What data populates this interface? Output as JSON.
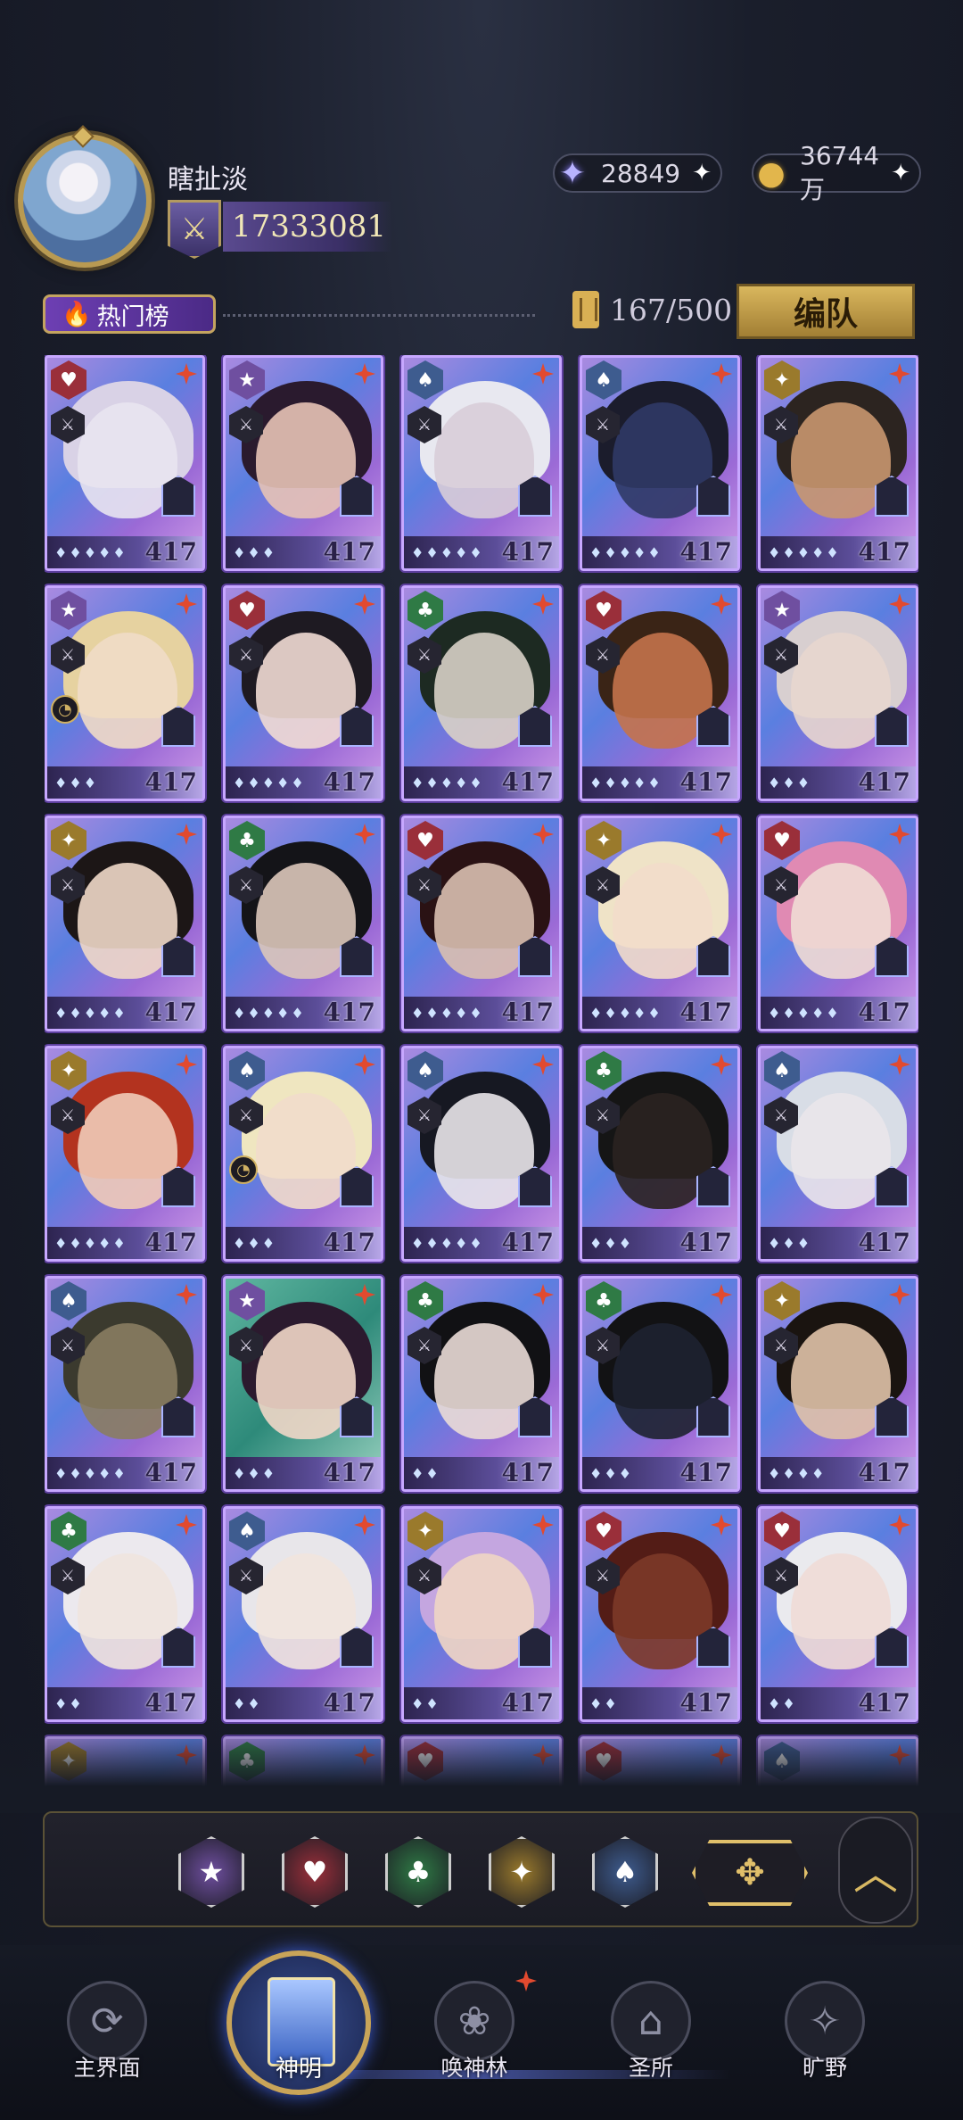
{
  "player": {
    "name": "瞎扯淡",
    "power": "17333081",
    "rank_icon": "crossed-swords-icon"
  },
  "currencies": [
    {
      "name": "crystal",
      "value": "28849",
      "icon": "crystal-star-icon",
      "add": "✦"
    },
    {
      "name": "gold",
      "value": "36744万",
      "icon": "gold-coin-icon",
      "add": "✦"
    }
  ],
  "subheader": {
    "hot_label": "热门榜",
    "capacity": "167/500",
    "team_button": "编队"
  },
  "suits": {
    "heart": {
      "symbol": "♥",
      "color": "#9a2f3a"
    },
    "star": {
      "symbol": "★",
      "color": "#6f4fa0"
    },
    "spade": {
      "symbol": "♠",
      "color": "#3e5c8f"
    },
    "club": {
      "symbol": "♣",
      "color": "#2f7a45"
    },
    "gold": {
      "symbol": "✦",
      "color": "#9a7a2c"
    }
  },
  "cards": [
    {
      "suit": "heart",
      "level": "417",
      "gems": "♦♦♦♦♦"
    },
    {
      "suit": "star",
      "level": "417",
      "gems": "♦♦♦"
    },
    {
      "suit": "spade",
      "level": "417",
      "gems": "♦♦♦♦♦"
    },
    {
      "suit": "spade",
      "level": "417",
      "gems": "♦♦♦♦♦"
    },
    {
      "suit": "gold",
      "level": "417",
      "gems": "♦♦♦♦♦"
    },
    {
      "suit": "star",
      "level": "417",
      "gems": "♦♦♦",
      "clock": true
    },
    {
      "suit": "heart",
      "level": "417",
      "gems": "♦♦♦♦♦"
    },
    {
      "suit": "club",
      "level": "417",
      "gems": "♦♦♦♦♦"
    },
    {
      "suit": "heart",
      "level": "417",
      "gems": "♦♦♦♦♦"
    },
    {
      "suit": "star",
      "level": "417",
      "gems": "♦♦♦"
    },
    {
      "suit": "gold",
      "level": "417",
      "gems": "♦♦♦♦♦"
    },
    {
      "suit": "club",
      "level": "417",
      "gems": "♦♦♦♦♦"
    },
    {
      "suit": "heart",
      "level": "417",
      "gems": "♦♦♦♦♦"
    },
    {
      "suit": "gold",
      "level": "417",
      "gems": "♦♦♦♦♦"
    },
    {
      "suit": "heart",
      "level": "417",
      "gems": "♦♦♦♦♦"
    },
    {
      "suit": "gold",
      "level": "417",
      "gems": "♦♦♦♦♦"
    },
    {
      "suit": "spade",
      "level": "417",
      "gems": "♦♦♦",
      "clock": true
    },
    {
      "suit": "spade",
      "level": "417",
      "gems": "♦♦♦♦♦"
    },
    {
      "suit": "club",
      "level": "417",
      "gems": "♦♦♦"
    },
    {
      "suit": "spade",
      "level": "417",
      "gems": "♦♦♦"
    },
    {
      "suit": "spade",
      "level": "417",
      "gems": "♦♦♦♦♦"
    },
    {
      "suit": "star",
      "level": "417",
      "gems": "♦♦♦"
    },
    {
      "suit": "club",
      "level": "417",
      "gems": "♦♦"
    },
    {
      "suit": "club",
      "level": "417",
      "gems": "♦♦♦"
    },
    {
      "suit": "gold",
      "level": "417",
      "gems": "♦♦♦♦"
    },
    {
      "suit": "club",
      "level": "417",
      "gems": "♦♦"
    },
    {
      "suit": "spade",
      "level": "417",
      "gems": "♦♦"
    },
    {
      "suit": "gold",
      "level": "417",
      "gems": "♦♦"
    },
    {
      "suit": "heart",
      "level": "417",
      "gems": "♦♦"
    },
    {
      "suit": "heart",
      "level": "417",
      "gems": "♦♦"
    }
  ],
  "peek_cards": [
    "gold",
    "club",
    "heart",
    "heart",
    "spade"
  ],
  "filters": [
    {
      "name": "star",
      "icon": "purple-star-icon"
    },
    {
      "name": "heart",
      "icon": "red-heart-icon"
    },
    {
      "name": "club",
      "icon": "green-club-icon"
    },
    {
      "name": "gold",
      "icon": "gold-star-icon"
    },
    {
      "name": "spade",
      "icon": "blue-spade-icon"
    }
  ],
  "filter_all_icon": "all-suits-icon",
  "collapse_icon": "chevron-up-icon",
  "nav": [
    {
      "label": "主界面",
      "icon": "main-interface-icon"
    },
    {
      "label": "神明",
      "icon": "gods-icon",
      "active": true
    },
    {
      "label": "唤神林",
      "icon": "summon-forest-icon"
    },
    {
      "label": "圣所",
      "icon": "sanctuary-icon"
    },
    {
      "label": "旷野",
      "icon": "wilderness-compass-icon"
    }
  ]
}
